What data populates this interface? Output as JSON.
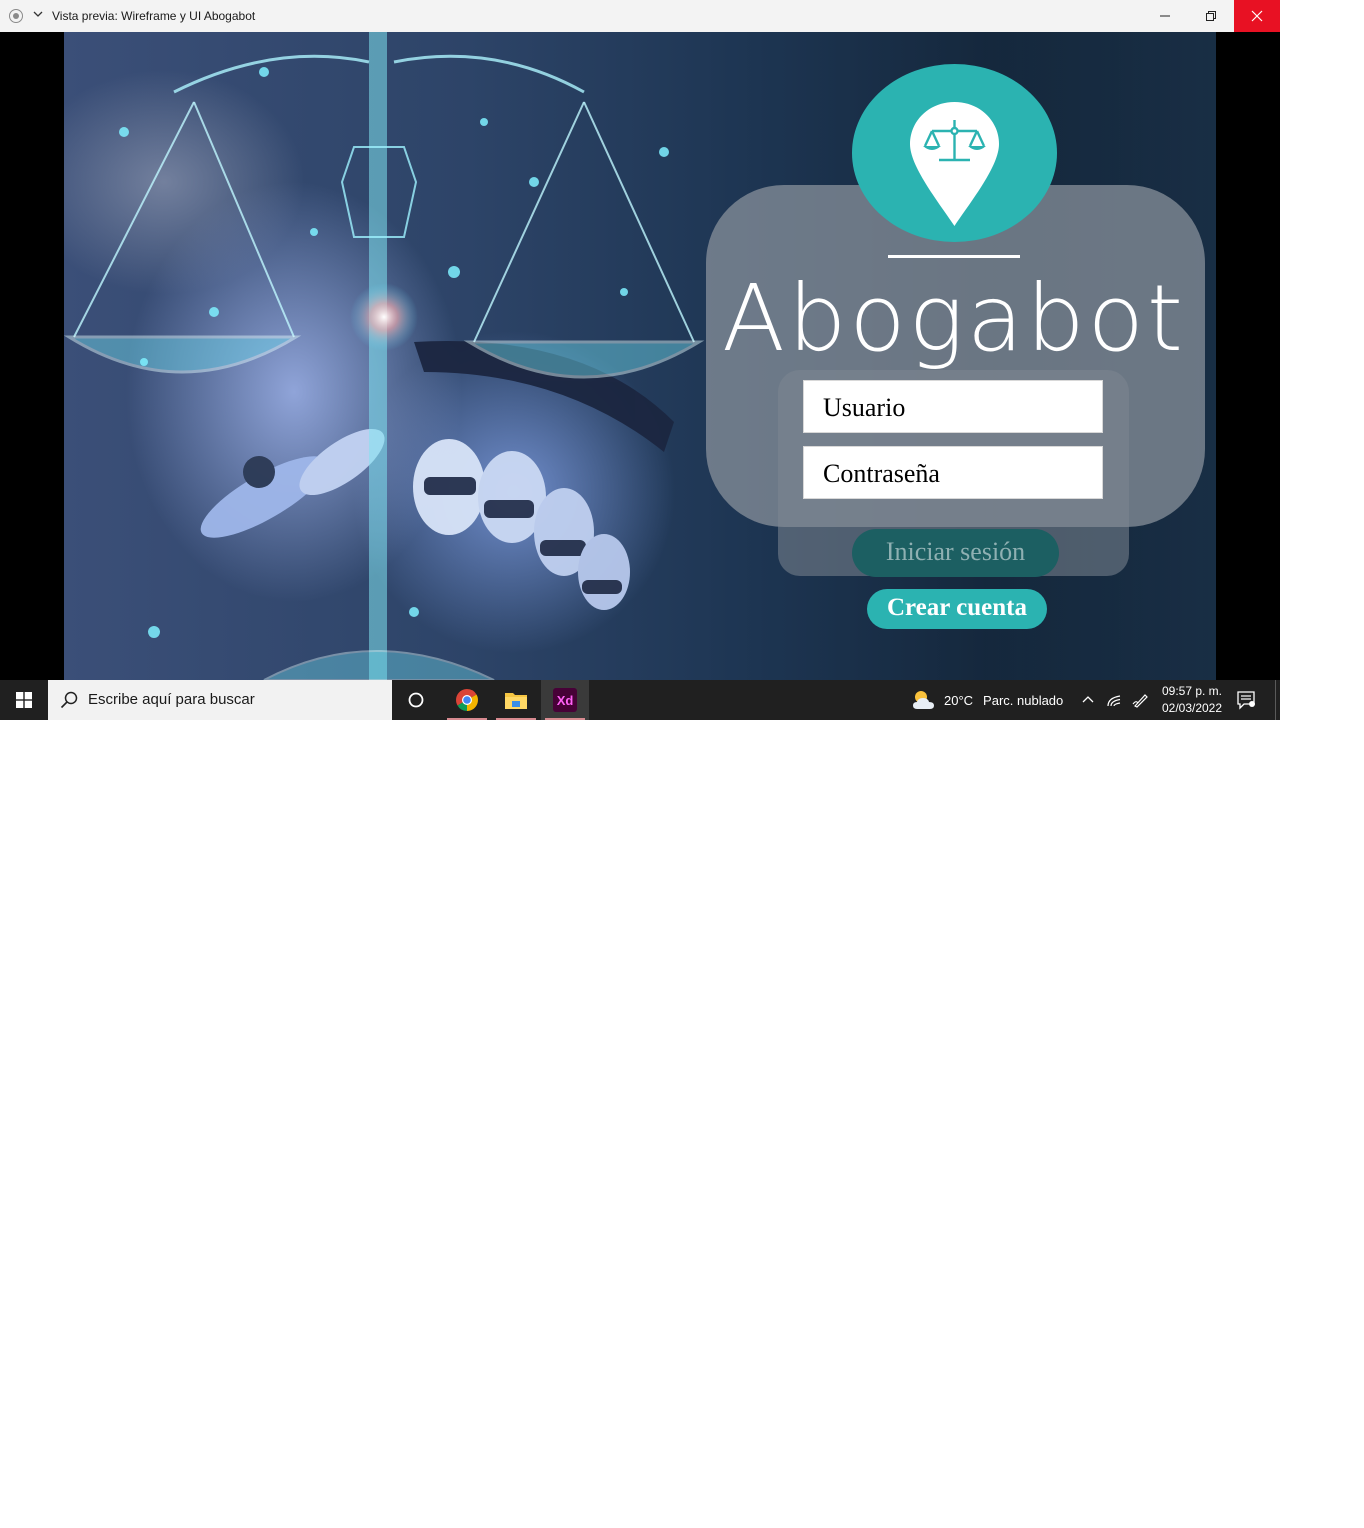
{
  "window": {
    "title": "Vista previa: Wireframe y UI Abogabot",
    "icons": [
      "preview-app-icon",
      "chevron-down-icon",
      "minimize-icon",
      "restore-icon",
      "close-icon"
    ]
  },
  "app": {
    "brand_name": "Abogabot",
    "logo_icon": "justice-scale-pin-icon",
    "username_placeholder": "Usuario",
    "password_placeholder": "Contraseña",
    "login_button": "Iniciar sesión",
    "create_account_button": "Crear cuenta",
    "colors": {
      "accent": "#2bb3b1",
      "login_button": "#1c5f62",
      "login_text": "#8fb0b2",
      "card": "#8c949e"
    }
  },
  "taskbar": {
    "search_placeholder": "Escribe aquí para buscar",
    "apps": [
      "cortana-icon",
      "chrome-icon",
      "file-explorer-icon",
      "adobe-xd-icon"
    ],
    "xd_label": "Xd",
    "weather_temp": "20°C",
    "weather_condition": "Parc. nublado",
    "time": "09:57 p. m.",
    "date": "02/03/2022"
  }
}
